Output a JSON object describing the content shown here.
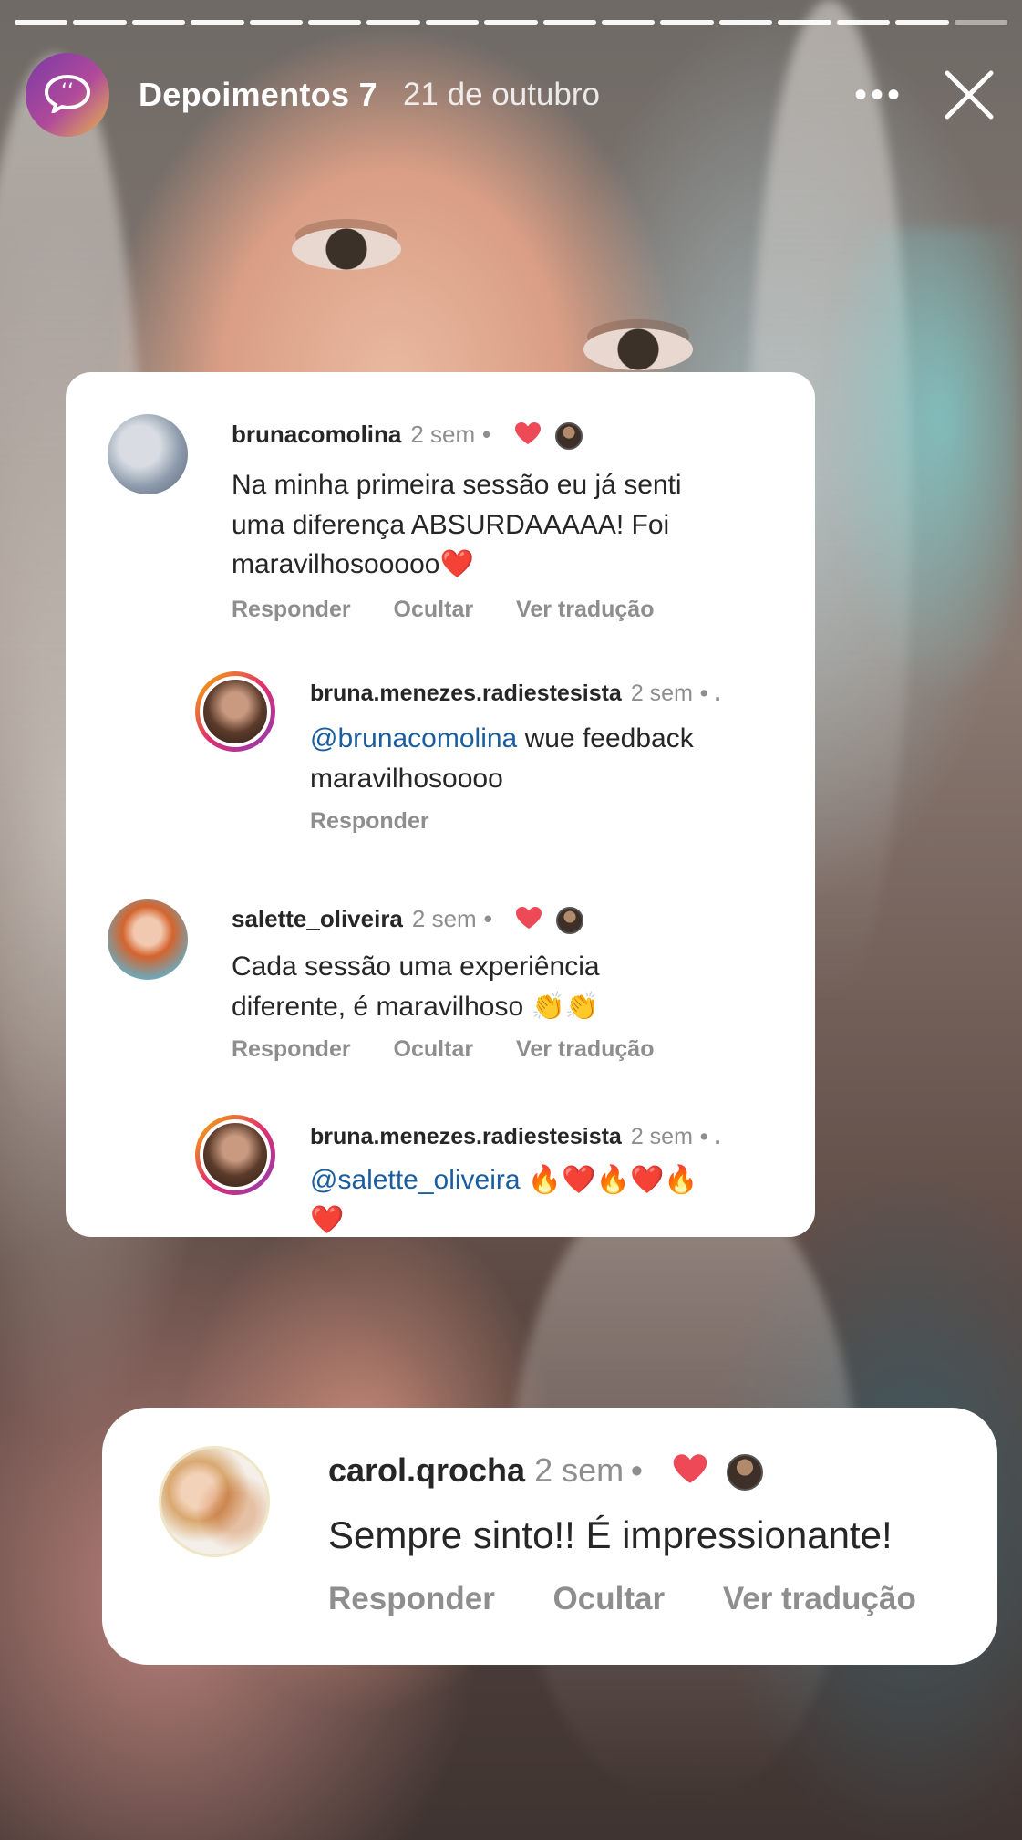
{
  "story": {
    "title": "Depoimentos 7",
    "date": "21 de outubro",
    "more_label": "•••",
    "progress": {
      "total_segments": 17,
      "current_segment": 16
    }
  },
  "comments_card_1": {
    "thread": [
      {
        "username": "brunacomolina",
        "time": "2 sem",
        "dot": "•",
        "text_line1": "Na minha primeira sessão eu já senti",
        "text_line2": "uma diferença ABSURDAAAAA! Foi",
        "text_line3": "maravilhosooooo❤️",
        "actions": {
          "reply": "Responder",
          "hide": "Ocultar",
          "translate": "Ver tradução"
        }
      },
      {
        "username": "bruna.menezes.radiestesista",
        "time": "2 sem",
        "dot": "• .",
        "mention": "@brunacomolina",
        "text_rest": " wue feedback",
        "text_line2": "maravilhosoooo",
        "actions": {
          "reply": "Responder"
        }
      },
      {
        "username": "salette_oliveira",
        "time": "2 sem",
        "dot": "•",
        "text_line1": "Cada sessão uma experiência",
        "text_line2": "diferente,  é maravilhoso 👏👏",
        "actions": {
          "reply": "Responder",
          "hide": "Ocultar",
          "translate": "Ver tradução"
        }
      },
      {
        "username": "bruna.menezes.radiestesista",
        "time": "2 sem",
        "dot": "• .",
        "mention": "@salette_oliveira",
        "text_rest": " 🔥❤️🔥❤️🔥",
        "text_line2": "❤️"
      }
    ]
  },
  "comments_card_2": {
    "username": "carol.qrocha",
    "time": "2 sem",
    "dot": "•",
    "text": "Sempre sinto!! É impressionante!",
    "actions": {
      "reply": "Responder",
      "hide": "Ocultar",
      "translate": "Ver tradução"
    }
  },
  "colors": {
    "accent_heart": "#ed4956",
    "mention_blue": "#1b5e9f",
    "meta_gray": "#8e8e8e"
  },
  "icons": {
    "story_avatar": "speech-bubble-icon",
    "close": "close-icon",
    "liked": "heart-icon"
  }
}
